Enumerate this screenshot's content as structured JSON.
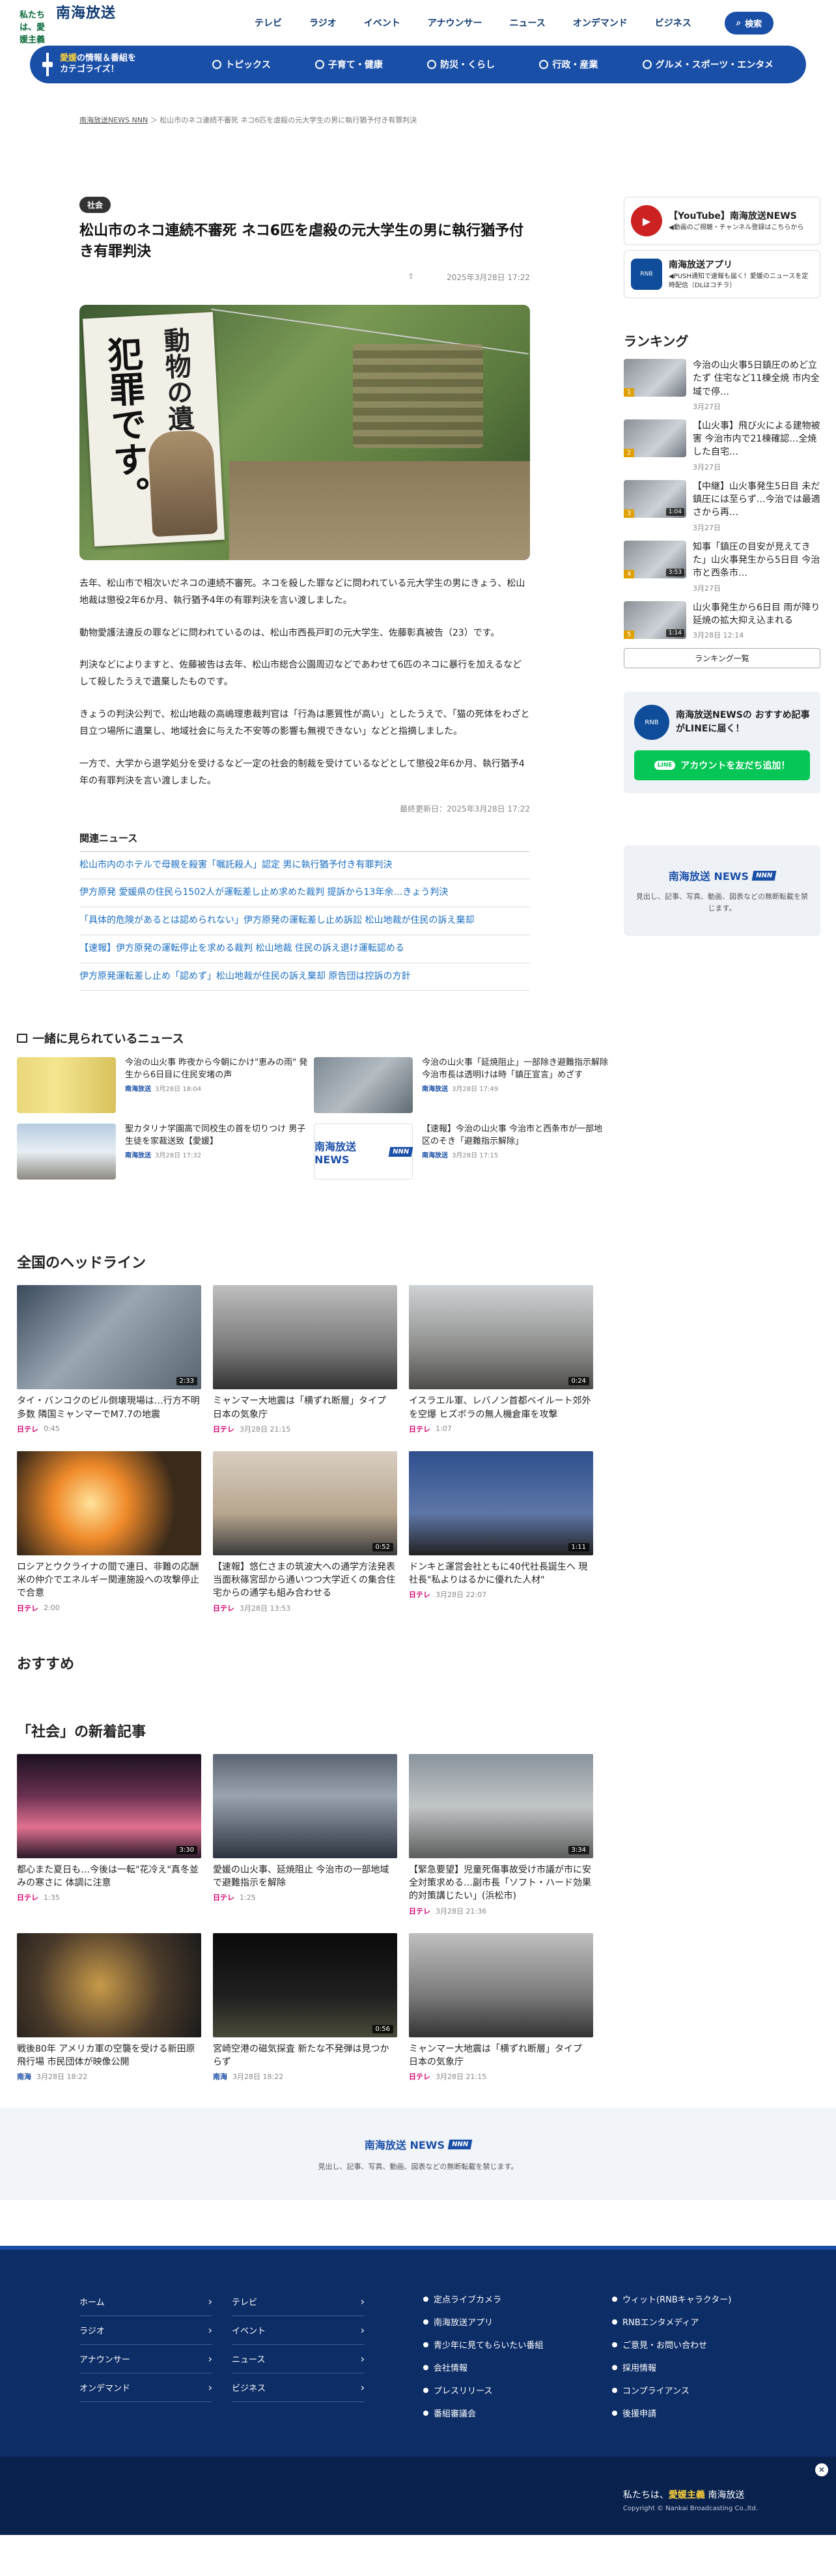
{
  "header": {
    "tagline_pre": "私たちは、",
    "tagline_em": "愛媛主義",
    "brand": "南海放送",
    "nav": [
      "テレビ",
      "ラジオ",
      "イベント",
      "アナウンサー",
      "ニュース",
      "オンデマンド",
      "ビジネス"
    ],
    "search": "検索"
  },
  "catbar": {
    "lead1": "愛媛",
    "lead2": "の情報＆番組を",
    "lead3": "カテゴライズ！",
    "cats": [
      "トピックス",
      "子育て・健康",
      "防災・くらし",
      "行政・産業",
      "グルメ・スポーツ・エンタメ"
    ]
  },
  "breadcrumb": {
    "root": "南海放送NEWS NNN",
    "current": "松山市のネコ連続不審死 ネコ6匹を虐殺の元大学生の男に執行猶予付き有罪判決"
  },
  "article": {
    "tag": "社会",
    "title": "松山市のネコ連続不審死 ネコ6匹を虐殺の元大学生の男に執行猶予付き有罪判決",
    "date": "2025年3月28日 17:22",
    "photo_text1": "犯罪です。",
    "photo_text2": "動物の遺",
    "paras": [
      "去年、松山市で相次いだネコの連続不審死。ネコを殺した罪などに問われている元大学生の男にきょう、松山地裁は懲役2年6か月、執行猶予4年の有罪判決を言い渡しました。",
      "動物愛護法違反の罪などに問われているのは、松山市西長戸町の元大学生、佐藤彰真被告（23）です。",
      "判決などによりますと、佐藤被告は去年、松山市総合公園周辺などであわせて6匹のネコに暴行を加えるなどして殺したうえで遺棄したものです。",
      "きょうの判決公判で、松山地裁の高嶋理恵裁判官は「行為は悪質性が高い」としたうえで、「猫の死体をわざと目立つ場所に遺棄し、地域社会に与えた不安等の影響も無視できない」などと指摘しました。",
      "一方で、大学から退学処分を受けるなど一定の社会的制裁を受けているなどとして懲役2年6か月、執行猶予4年の有罪判決を言い渡しました。"
    ],
    "updated": "最終更新日：2025年3月28日 17:22"
  },
  "related": {
    "title": "関連ニュース",
    "items": [
      "松山市内のホテルで母親を殺害「嘱託殺人」認定 男に執行猶予付き有罪判決",
      "伊方原発 愛媛県の住民ら1502人が運転差し止め求めた裁判 提訴から13年余…きょう判決",
      "「具体的危険があるとは認められない」伊方原発の運転差し止め訴訟 松山地裁が住民の訴え棄却",
      "【速報】伊方原発の運転停止を求める裁判 松山地裁 住民の訴え退け運転認める",
      "伊方原発運転差し止め「認めず」松山地裁が住民の訴え棄却 原告団は控訴の方針"
    ]
  },
  "sidebar": {
    "yt_title": "【YouTube】南海放送NEWS",
    "yt_desc": "◀動画のご視聴・チャンネル登録はこちらから",
    "app_title": "南海放送アプリ",
    "app_desc": "◀PUSH通知で速報も届く！愛媛のニュースを定時配信（DLはコチラ）",
    "ranking": "ランキング",
    "ranks": [
      {
        "n": "1",
        "t": "今治の山火事5日鎮圧のめど立たず 住宅など11棟全焼 市内全域で停…",
        "d": "3月27日",
        "dur": ""
      },
      {
        "n": "2",
        "t": "【山火事】飛び火による建物被害 今治市内で21棟確認…全焼した自宅…",
        "d": "3月27日",
        "dur": ""
      },
      {
        "n": "3",
        "t": "【中継】山火事発生5日目 未だ鎮圧には至らず…今治では最適さから再…",
        "d": "3月27日",
        "dur": "1:04"
      },
      {
        "n": "4",
        "t": "知事「鎮圧の目安が見えてきた」山火事発生から5日目 今治市と西条市…",
        "d": "3月27日",
        "dur": "3:53"
      },
      {
        "n": "5",
        "t": "山火事発生から6日目 雨が降り延焼の拡大抑え込まれる",
        "d": "3月28日 12:14",
        "dur": "1:14"
      }
    ],
    "rank_more": "ランキング一覧",
    "line_text": "南海放送NEWSの おすすめ記事がLINEに届く！",
    "line_btn": "アカウントを友だち追加！",
    "line_logo": "LINE",
    "news_logo_note": "見出し、記事、写真、動画、図表などの無断転載を禁じます。"
  },
  "together": {
    "title": "一緒に見られているニュース",
    "items": [
      {
        "t": "今治の山火事 昨夜から今朝にかけ\"恵みの雨\" 発生から6日目に住民安堵の声",
        "s": "南海放送",
        "d": "3月28日 18:04"
      },
      {
        "t": "今治の山火事「延焼阻止」一部除き避難指示解除 今治市長は透明けは時「鎮圧宣言」めざす",
        "s": "南海放送",
        "d": "3月28日 17:49"
      },
      {
        "t": "聖カタリナ学園高で同校生の首を切りつけ 男子生徒を家裁送致【愛媛】",
        "s": "南海放送",
        "d": "3月28日 17:32"
      },
      {
        "t": "【速報】今治の山火事 今治市と西条市が一部地区のそき「避難指示解除」",
        "s": "南海放送",
        "d": "3月28日 17:15"
      }
    ]
  },
  "headlines": {
    "title": "全国のヘッドライン",
    "items": [
      {
        "t": "タイ・バンコクのビル倒壊現場は…行方不明多数 隣国ミャンマーでM7.7の地震",
        "d": "0:45",
        "dur": "2:33",
        "src": "日テレ"
      },
      {
        "t": "ミャンマー大地震は「横ずれ断層」タイプ 日本の気象庁",
        "d": "3月28日 21:15",
        "dur": "",
        "src": "日テレ"
      },
      {
        "t": "イスラエル軍、レバノン首都ベイルート郊外を空爆 ヒズボラの無人機倉庫を攻撃",
        "d": "1:07",
        "dur": "0:24",
        "src": "日テレ"
      },
      {
        "t": "ロシアとウクライナの間で連日、非難の応酬 米の仲介でエネルギー関連施設への攻撃停止で合意",
        "d": "2:00",
        "dur": "",
        "src": "日テレ"
      },
      {
        "t": "【速報】悠仁さまの筑波大への通学方法発表 当面秋篠宮邸から通いつつ大学近くの集合住宅からの通学も組み合わせる",
        "d": "3月28日 13:53",
        "dur": "0:52",
        "src": "日テレ"
      },
      {
        "t": "ドンキと運営会社ともに40代社長誕生へ 現社長\"私よりはるかに優れた人材\"",
        "d": "3月28日 22:07",
        "dur": "1:11",
        "src": "日テレ"
      }
    ]
  },
  "osusume": "おすすめ",
  "shakai": {
    "title": "「社会」の新着記事",
    "items": [
      {
        "t": "都心また夏日も…今後は一転\"花冷え\"真冬並みの寒さに 体調に注意",
        "d": "1:35",
        "dur": "3:30",
        "src": "日テレ"
      },
      {
        "t": "愛媛の山火事、延焼阻止 今治市の一部地域で避難指示を解除",
        "d": "1:25",
        "dur": "",
        "src": "日テレ"
      },
      {
        "t": "【緊急要望】児童死傷事故受け市議が市に安全対策求める…副市長「ソフト・ハード効果的対策講じたい」(浜松市)",
        "d": "3月28日 21:36",
        "dur": "3:34",
        "src": "日テレ"
      },
      {
        "t": "戦後80年 アメリカ軍の空襲を受ける新田原飛行場 市民団体が映像公開",
        "d": "3月28日 18:22",
        "dur": "",
        "src": "南海"
      },
      {
        "t": "宮崎空港の磁気探査 新たな不発弾は見つからず",
        "d": "3月28日 18:22",
        "dur": "0:56",
        "src": "南海"
      },
      {
        "t": "ミャンマー大地震は「横ずれ断層」タイプ 日本の気象庁",
        "d": "3月28日 21:15",
        "dur": "",
        "src": "日テレ"
      }
    ]
  },
  "footer": {
    "col1": [
      "ホーム",
      "ラジオ",
      "アナウンサー",
      "オンデマンド"
    ],
    "col2": [
      "テレビ",
      "イベント",
      "ニュース",
      "ビジネス"
    ],
    "col3": [
      "定点ライブカメラ",
      "南海放送アプリ",
      "青少年に見てもらいたい番組",
      "会社情報",
      "プレスリリース",
      "番組審議会"
    ],
    "col4": [
      "ウィット(RNBキャラクター)",
      "RNBエンタメディア",
      "ご意見・お問い合わせ",
      "採用情報",
      "コンプライアンス",
      "後援申請"
    ],
    "tag_pre": "私たちは、",
    "tag_em": "愛媛主義",
    "brand": "南海放送",
    "copyright": "Copyright © Nankai Broadcasting Co.,ltd."
  },
  "nnn": {
    "name": "南海放送 NEWS",
    "badge": "NNN"
  }
}
